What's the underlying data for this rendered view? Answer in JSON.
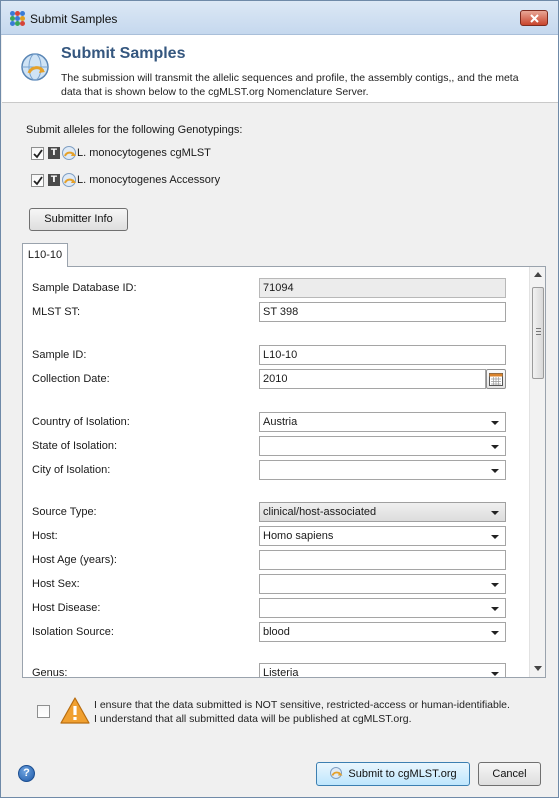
{
  "window": {
    "title": "Submit Samples"
  },
  "header": {
    "title": "Submit Samples",
    "description": "The submission will transmit the allelic sequences and profile, the assembly contigs,, and the meta data that is shown below to the cgMLST.org Nomenclature Server."
  },
  "genotypings": {
    "label": "Submit alleles for the following Genotypings:",
    "items": [
      {
        "label": "L. monocytogenes cgMLST",
        "checked": true,
        "badge": "T"
      },
      {
        "label": "L. monocytogenes Accessory",
        "checked": true,
        "badge": "T"
      }
    ]
  },
  "submitter_button": "Submitter Info",
  "tab": {
    "label": "L10-10"
  },
  "form": {
    "sample_db_id": {
      "label": "Sample Database ID:",
      "value": "71094"
    },
    "mlst_st": {
      "label": "MLST ST:",
      "value": "ST 398"
    },
    "sample_id": {
      "label": "Sample ID:",
      "value": "L10-10"
    },
    "collection_date": {
      "label": "Collection Date:",
      "value": "2010"
    },
    "country": {
      "label": "Country of Isolation:",
      "value": "Austria"
    },
    "state": {
      "label": "State of Isolation:",
      "value": ""
    },
    "city": {
      "label": "City of Isolation:",
      "value": ""
    },
    "source_type": {
      "label": "Source Type:",
      "value": "clinical/host-associated"
    },
    "host": {
      "label": "Host:",
      "value": "Homo sapiens"
    },
    "host_age": {
      "label": "Host Age (years):",
      "value": ""
    },
    "host_sex": {
      "label": "Host Sex:",
      "value": ""
    },
    "host_disease": {
      "label": "Host Disease:",
      "value": ""
    },
    "isolation_source": {
      "label": "Isolation Source:",
      "value": "blood"
    },
    "genus": {
      "label": "Genus:",
      "value": "Listeria"
    }
  },
  "agreement": {
    "checked": false,
    "line1": "I ensure that the data submitted is NOT sensitive, restricted-access or human-identifiable.",
    "line2": "I understand that all submitted data will be published at cgMLST.org."
  },
  "footer": {
    "help": "?",
    "submit_label": "Submit to cgMLST.org",
    "cancel_label": "Cancel"
  },
  "icons": {
    "app": "app-grid-icon",
    "header": "cgmlst-globe-icon",
    "calendar": "calendar-icon",
    "warning": "warning-icon",
    "help": "help-icon"
  },
  "colors": {
    "header_title": "#35577f",
    "warning": "#f0a030",
    "close_button": "#c9452d"
  }
}
